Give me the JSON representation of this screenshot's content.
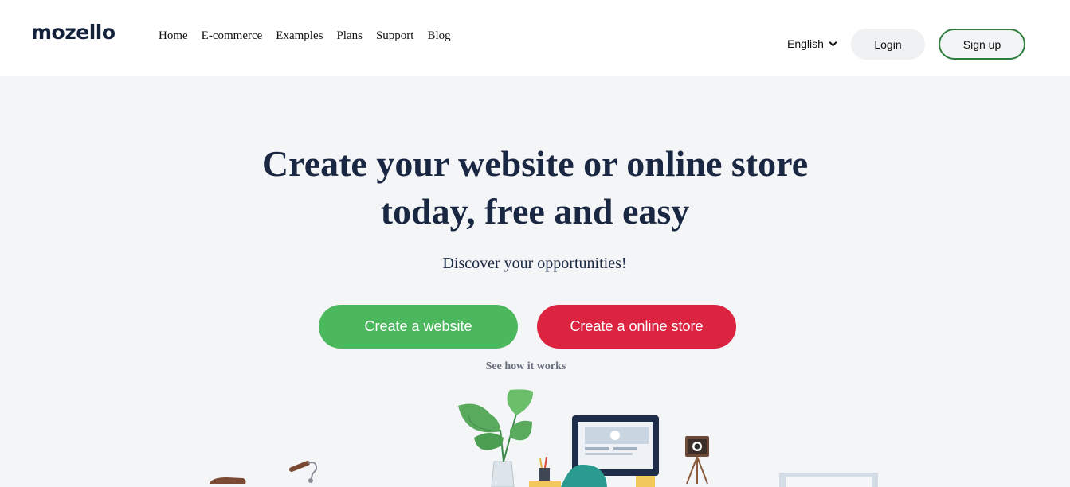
{
  "header": {
    "logo": "mozello",
    "nav": [
      "Home",
      "E-commerce",
      "Examples",
      "Plans",
      "Support",
      "Blog"
    ],
    "language": "English",
    "login_label": "Login",
    "signup_label": "Sign up"
  },
  "hero": {
    "title_line1": "Create your website or online store",
    "title_line2": "today, free and easy",
    "subtitle": "Discover your opportunities!",
    "create_website_label": "Create a website",
    "create_store_label": "Create a online store",
    "see_how_label": "See how it works"
  },
  "colors": {
    "green": "#4cb85e",
    "red": "#dc2340",
    "navy": "#1a2742",
    "signup_border": "#2f7d3e"
  },
  "illustration": {
    "icons": [
      "bicycle-icon",
      "plant-icon",
      "monitor-icon",
      "camera-icon",
      "frame-icon"
    ]
  }
}
